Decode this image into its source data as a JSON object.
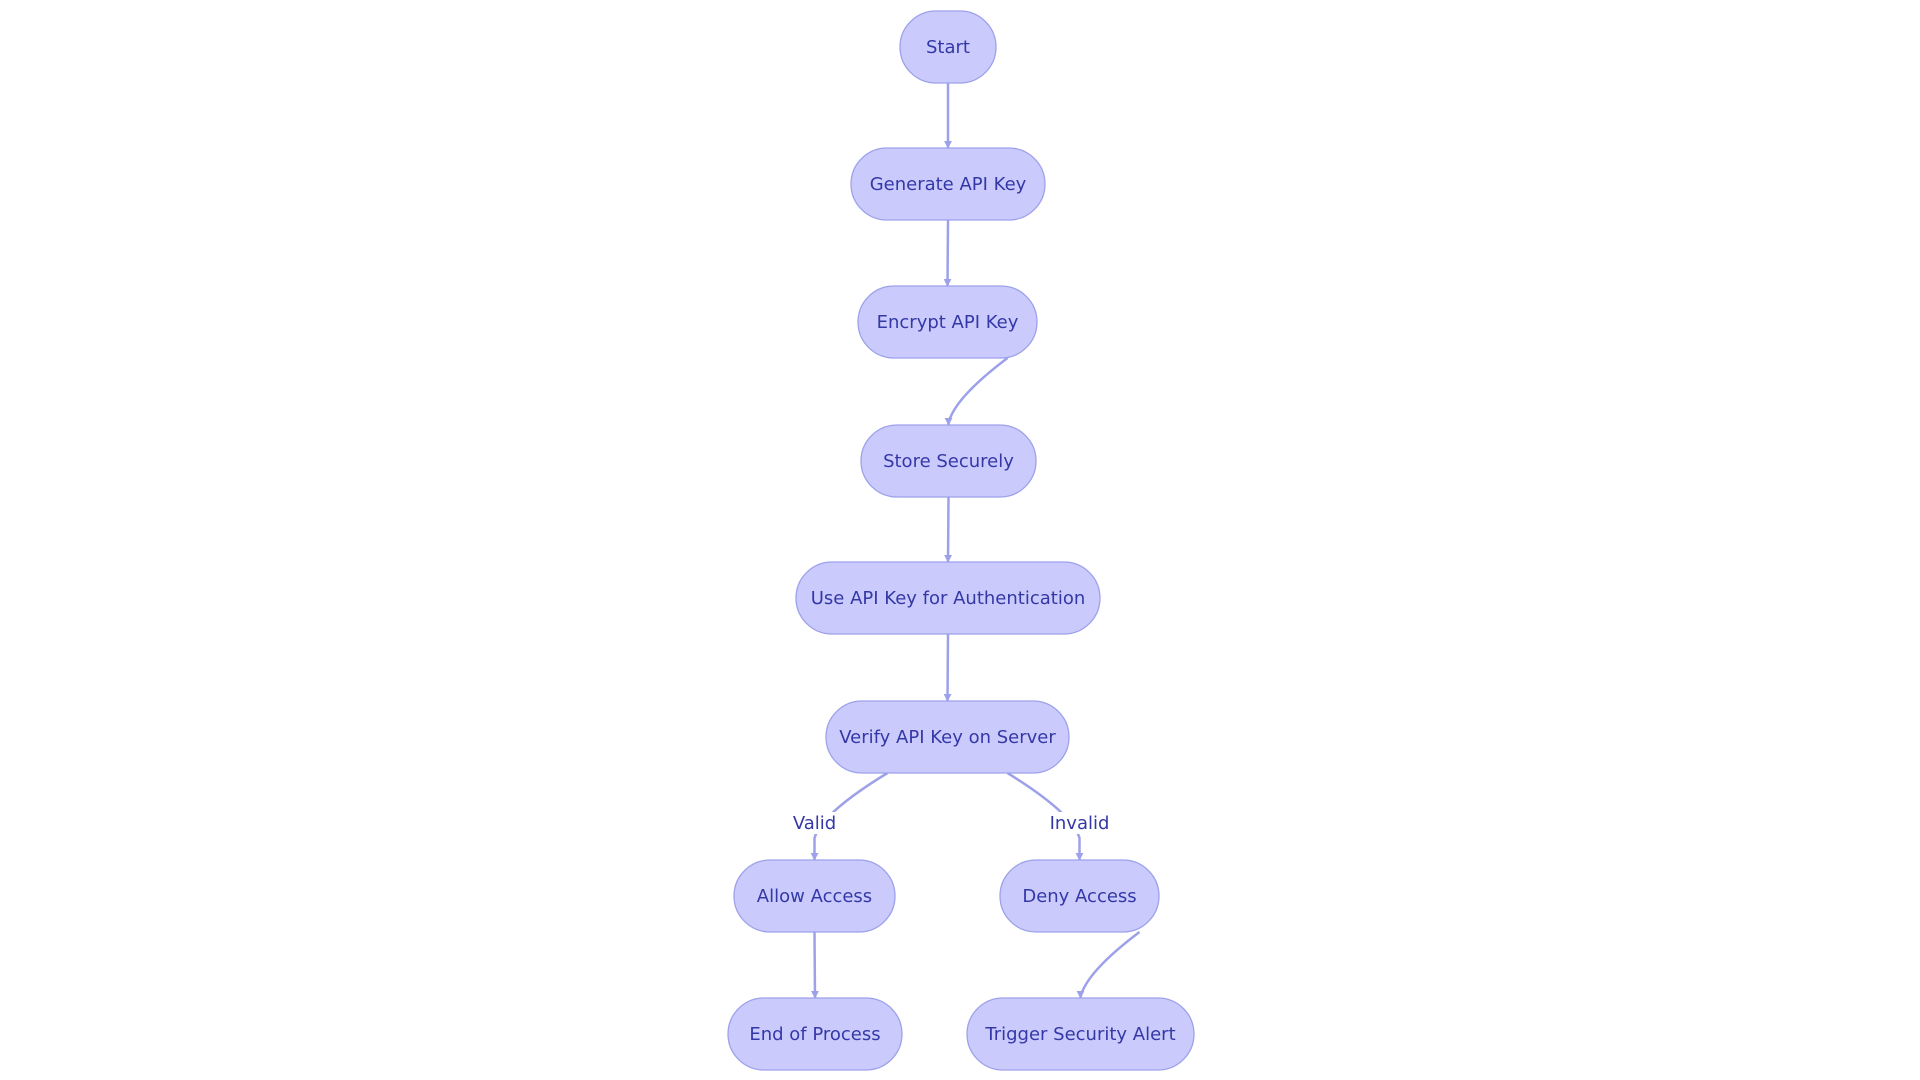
{
  "diagram": {
    "type": "flowchart",
    "colors": {
      "node_fill": "#cacbfc",
      "node_stroke": "#9da1ea",
      "text": "#3438a6",
      "edge": "#9da1ea"
    },
    "nodes": [
      {
        "id": "start",
        "label": "Start"
      },
      {
        "id": "generate",
        "label": "Generate API Key"
      },
      {
        "id": "encrypt",
        "label": "Encrypt API Key"
      },
      {
        "id": "store",
        "label": "Store Securely"
      },
      {
        "id": "use",
        "label": "Use API Key for Authentication"
      },
      {
        "id": "verify",
        "label": "Verify API Key on Server"
      },
      {
        "id": "allow",
        "label": "Allow Access"
      },
      {
        "id": "deny",
        "label": "Deny Access"
      },
      {
        "id": "end",
        "label": "End of Process"
      },
      {
        "id": "alert",
        "label": "Trigger Security Alert"
      }
    ],
    "edges": [
      {
        "from": "start",
        "to": "generate",
        "label": ""
      },
      {
        "from": "generate",
        "to": "encrypt",
        "label": ""
      },
      {
        "from": "encrypt",
        "to": "store",
        "label": ""
      },
      {
        "from": "store",
        "to": "use",
        "label": ""
      },
      {
        "from": "use",
        "to": "verify",
        "label": ""
      },
      {
        "from": "verify",
        "to": "allow",
        "label": "Valid"
      },
      {
        "from": "verify",
        "to": "deny",
        "label": "Invalid"
      },
      {
        "from": "allow",
        "to": "end",
        "label": ""
      },
      {
        "from": "deny",
        "to": "alert",
        "label": ""
      }
    ]
  }
}
